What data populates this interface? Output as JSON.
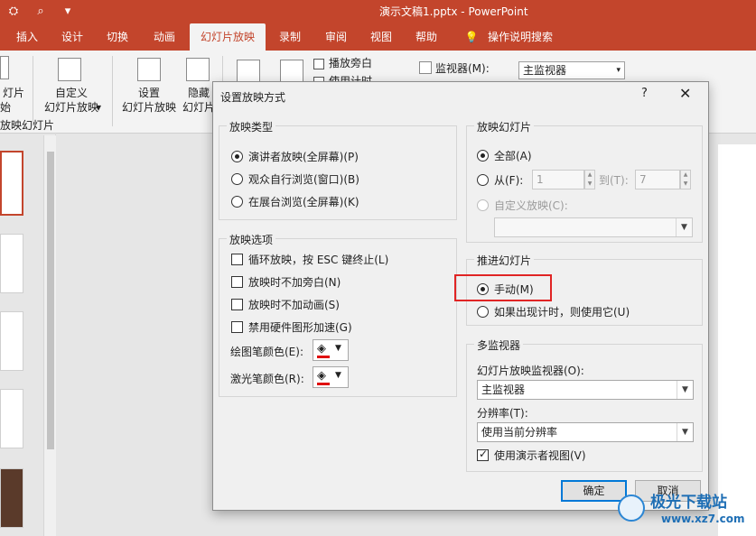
{
  "titlebar": {
    "doc_title": "演示文稿1.pptx  -  PowerPoint",
    "qat_icons": [
      "presenter-icon",
      "preview-icon",
      "customize-icon"
    ]
  },
  "tabs": [
    {
      "label": "插入"
    },
    {
      "label": "设计"
    },
    {
      "label": "切换"
    },
    {
      "label": "动画"
    },
    {
      "label": "幻灯片放映",
      "active": true
    },
    {
      "label": "录制"
    },
    {
      "label": "审阅"
    },
    {
      "label": "视图"
    },
    {
      "label": "帮助"
    },
    {
      "label": "操作说明搜索"
    }
  ],
  "ribbon": {
    "from_start_label": "灯片",
    "from_start_sub": "始",
    "custom_show_label": "自定义",
    "custom_show_sub": "幻灯片放映",
    "setup_label": "设置",
    "setup_sub": "幻灯片放映",
    "hide_label": "隐藏",
    "hide_sub": "幻灯片",
    "group_label": "放映幻灯片",
    "play_narration": "播放旁白",
    "use_timing": "使用计时",
    "monitor_label": "监视器(M):",
    "monitor_value": "主监视器"
  },
  "dialog": {
    "title": "设置放映方式",
    "help": "?",
    "close": "✕",
    "show_type": {
      "title": "放映类型",
      "options": [
        {
          "label": "演讲者放映(全屏幕)(P)",
          "selected": true
        },
        {
          "label": "观众自行浏览(窗口)(B)",
          "selected": false
        },
        {
          "label": "在展台浏览(全屏幕)(K)",
          "selected": false
        }
      ]
    },
    "show_options": {
      "title": "放映选项",
      "checks": [
        {
          "label": "循环放映，按 ESC 键终止(L)",
          "checked": false
        },
        {
          "label": "放映时不加旁白(N)",
          "checked": false
        },
        {
          "label": "放映时不加动画(S)",
          "checked": false
        },
        {
          "label": "禁用硬件图形加速(G)",
          "checked": false
        }
      ],
      "pen_color_label": "绘图笔颜色(E):",
      "laser_color_label": "激光笔颜色(R):",
      "pen_color": "#e01010",
      "laser_color": "#e01010"
    },
    "show_slides": {
      "title": "放映幻灯片",
      "all_label": "全部(A)",
      "from_label": "从(F):",
      "from_value": "1",
      "to_label": "到(T):",
      "to_value": "7",
      "custom_label": "自定义放映(C):",
      "custom_value": ""
    },
    "advance": {
      "title": "推进幻灯片",
      "manual_label": "手动(M)",
      "timing_label": "如果出现计时，则使用它(U)",
      "manual_selected": true
    },
    "multi_monitor": {
      "title": "多监视器",
      "monitor_label": "幻灯片放映监视器(O):",
      "monitor_value": "主监视器",
      "resolution_label": "分辨率(T):",
      "resolution_value": "使用当前分辨率",
      "presenter_view_label": "使用演示者视图(V)",
      "presenter_view_checked": true
    },
    "ok_label": "确定",
    "cancel_label": "取消"
  },
  "watermark": {
    "brand": "极光下载站",
    "url": "www.xz7.com"
  }
}
